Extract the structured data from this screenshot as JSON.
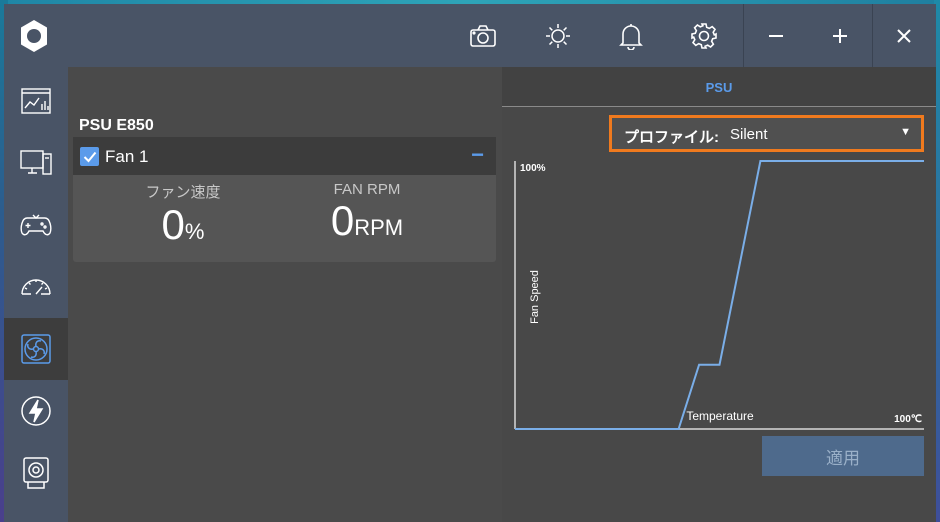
{
  "titlebar": {
    "icons": [
      "camera-icon",
      "brightness-icon",
      "bell-icon",
      "gear-icon"
    ],
    "window_controls": [
      "minimize-icon",
      "maximize-icon",
      "close-icon"
    ]
  },
  "sidebar": {
    "items": [
      {
        "icon": "dashboard-icon",
        "active": false
      },
      {
        "icon": "monitor-icon",
        "active": false
      },
      {
        "icon": "gamepad-icon",
        "active": false
      },
      {
        "icon": "speedometer-icon",
        "active": false
      },
      {
        "icon": "fan-icon",
        "active": true
      },
      {
        "icon": "lightning-icon",
        "active": false
      },
      {
        "icon": "webcam-icon",
        "active": false
      }
    ]
  },
  "device": {
    "title": "PSU E850",
    "fan": {
      "name": "Fan 1",
      "checked": true,
      "collapse_symbol": "−",
      "speed_label": "ファン速度",
      "speed_value": "0",
      "speed_unit": "%",
      "rpm_label": "FAN RPM",
      "rpm_value": "0",
      "rpm_unit": "RPM"
    }
  },
  "right": {
    "tab": "PSU",
    "profile_label": "プロファイル:",
    "profile_value": "Silent",
    "apply_label": "適用"
  },
  "colors": {
    "accent": "#5b9bea",
    "highlight_border": "#f07a1e",
    "curve": "#7aaee8"
  },
  "chart_data": {
    "type": "line",
    "ylabel": "Fan Speed",
    "xlabel": "Temperature",
    "y_max_label": "100%",
    "x_max_label": "100℃",
    "xlim": [
      0,
      100
    ],
    "ylim": [
      0,
      100
    ],
    "series": [
      {
        "x": [
          0,
          40,
          45,
          50,
          60,
          100
        ],
        "y": [
          0,
          0,
          24,
          24,
          100,
          100
        ]
      }
    ]
  }
}
